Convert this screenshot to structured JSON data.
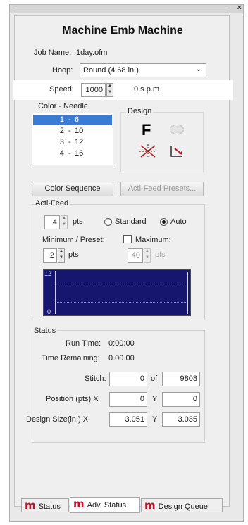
{
  "title": "Machine Emb Machine",
  "job": {
    "label": "Job Name:",
    "value": "1day.ofm"
  },
  "hoop": {
    "label": "Hoop:",
    "value": "Round (4.68 in.)"
  },
  "speed": {
    "label": "Speed:",
    "value": "1000",
    "unit": "0 s.p.m."
  },
  "color_needle": {
    "label": "Color - Needle",
    "items": [
      {
        "color": "1",
        "needle": "6"
      },
      {
        "color": "2",
        "needle": "10"
      },
      {
        "color": "3",
        "needle": "12"
      },
      {
        "color": "4",
        "needle": "16"
      }
    ]
  },
  "design": {
    "label": "Design",
    "icon_f": "F"
  },
  "buttons": {
    "color_sequence": "Color Sequence",
    "actifeed_presets": "Acti-Feed Presets..."
  },
  "actifeed": {
    "label": "Acti-Feed",
    "pts_value": "4",
    "pts_unit": "pts",
    "standard": "Standard",
    "auto": "Auto",
    "mode": "Auto",
    "minimum_label": "Minimum / Preset:",
    "maximum_label": "Maximum:",
    "min_value": "2",
    "min_unit": "pts",
    "max_value": "40",
    "max_unit": "pts",
    "graph_top": "12",
    "graph_bottom": "0"
  },
  "status": {
    "label": "Status",
    "run_time_label": "Run Time:",
    "run_time": "0:00:00",
    "remaining_label": "Time Remaining:",
    "remaining": "0.00.00",
    "stitch_label": "Stitch:",
    "stitch": "0",
    "of_label": "of",
    "stitch_total": "9808",
    "position_label": "Position (pts) X",
    "pos_x": "0",
    "y_label": "Y",
    "pos_y": "0",
    "size_label": "Design Size(in.) X",
    "size_x": "3.051",
    "size_y": "3.035"
  },
  "tabs": [
    {
      "icon": "m",
      "label": "Status"
    },
    {
      "icon": "m",
      "label": "Adv. Status"
    },
    {
      "icon": "m",
      "label": "Design Queue"
    }
  ],
  "colors": {
    "selection": "#3a7bd5",
    "graph_bg": "#16166e",
    "tab_icon": "#c0122a"
  }
}
